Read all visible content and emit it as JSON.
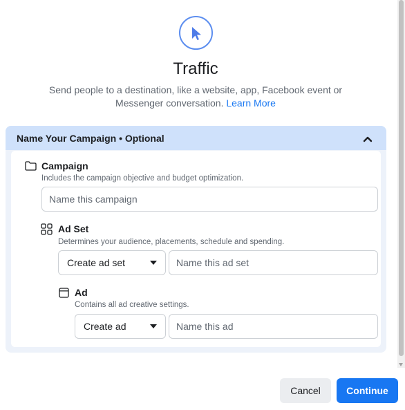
{
  "objective": {
    "icon": "cursor-icon",
    "title": "Traffic",
    "description": "Send people to a destination, like a website, app, Facebook event or Messenger conversation.",
    "learn_more": "Learn More"
  },
  "panel": {
    "header": "Name Your Campaign • Optional",
    "campaign": {
      "icon": "folder-icon",
      "title": "Campaign",
      "description": "Includes the campaign objective and budget optimization.",
      "placeholder": "Name this campaign"
    },
    "ad_set": {
      "icon": "grid-icon",
      "title": "Ad Set",
      "description": "Determines your audience, placements, schedule and spending.",
      "select_value": "Create ad set",
      "placeholder": "Name this ad set"
    },
    "ad": {
      "icon": "ad-window-icon",
      "title": "Ad",
      "description": "Contains all ad creative settings.",
      "select_value": "Create ad",
      "placeholder": "Name this ad"
    }
  },
  "footer": {
    "cancel_label": "Cancel",
    "continue_label": "Continue"
  },
  "colors": {
    "accent": "#1877f2",
    "panel_header": "#cfe1fb",
    "panel_bg": "#edf2fa"
  }
}
